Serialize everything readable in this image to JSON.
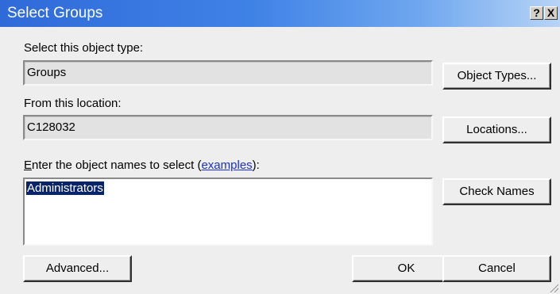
{
  "window": {
    "title": "Select Groups",
    "help_glyph": "?",
    "close_glyph": "X"
  },
  "object_type": {
    "label": "Select this object type:",
    "value": "Groups",
    "button": "Object Types..."
  },
  "location": {
    "label": "From this location:",
    "value": "C128032",
    "button": "Locations..."
  },
  "names": {
    "label_e": "E",
    "label_rest": "nter the object names to select (",
    "label_link": "examples",
    "label_end": "):",
    "value": "Administrators",
    "button": "Check Names"
  },
  "footer": {
    "advanced": "Advanced...",
    "ok": "OK",
    "cancel": "Cancel"
  },
  "colors": {
    "titlebar_start": "#2f6ad9",
    "dialog_bg": "#eeeeee",
    "selection": "#0a246a",
    "link": "#1a30c8"
  }
}
